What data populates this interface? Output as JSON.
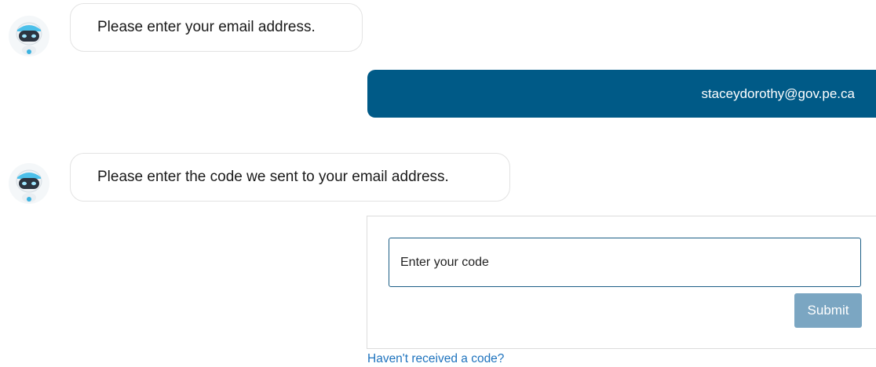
{
  "chat": {
    "messages": [
      {
        "sender": "bot",
        "text": "Please enter your email address."
      },
      {
        "sender": "user",
        "text": "staceydorothy@gov.pe.ca"
      },
      {
        "sender": "bot",
        "text": "Please enter the code we sent to your email address."
      }
    ],
    "avatar_icon": "robot-avatar-icon"
  },
  "code_form": {
    "input_placeholder": "Enter your code",
    "input_value": "",
    "submit_label": "Submit",
    "resend_link_label": "Haven't received a code?"
  },
  "colors": {
    "user_bubble": "#005a87",
    "submit_disabled": "#7ba6c2",
    "input_border": "#1c5e86",
    "link": "#1e73be"
  }
}
